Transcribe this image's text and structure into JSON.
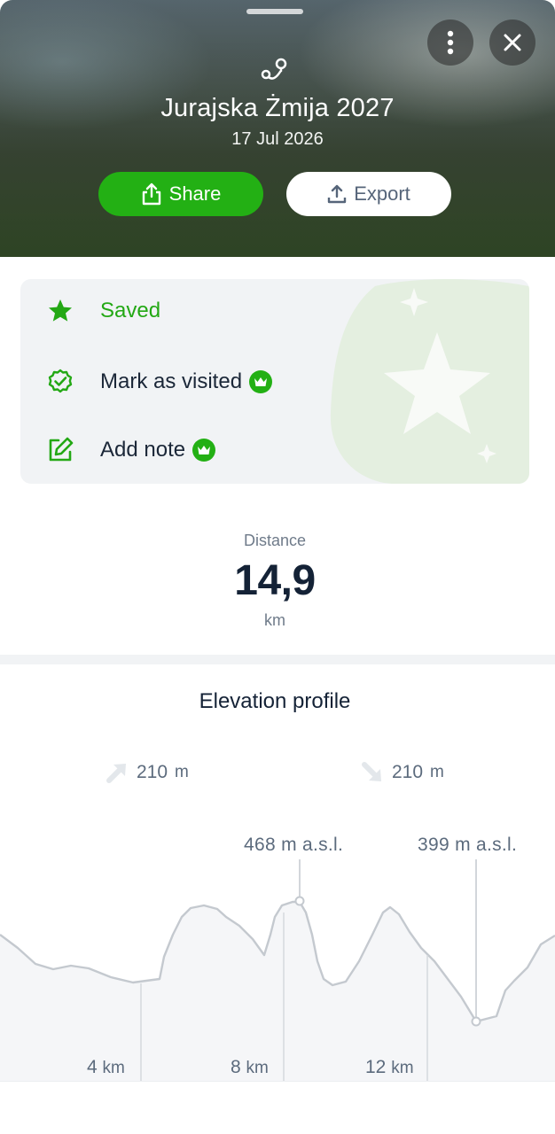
{
  "header": {
    "title": "Jurajska Żmija 2027",
    "date": "17 Jul 2026",
    "share_label": "Share",
    "export_label": "Export",
    "icons": [
      "more-vertical-icon",
      "close-icon",
      "route-icon",
      "share-icon",
      "upload-icon"
    ]
  },
  "card": {
    "items": [
      {
        "label": "Saved",
        "icon": "star-icon",
        "premium": false
      },
      {
        "label": "Mark as visited",
        "icon": "check-badge-icon",
        "premium": true
      },
      {
        "label": "Add note",
        "icon": "edit-note-icon",
        "premium": true
      }
    ]
  },
  "distance": {
    "label": "Distance",
    "value": "14,9",
    "unit": "km"
  },
  "elevation": {
    "title": "Elevation profile",
    "ascent": {
      "value": "210",
      "unit": "m"
    },
    "descent": {
      "value": "210",
      "unit": "m"
    },
    "peaks": [
      {
        "label": "468 m a.s.l."
      },
      {
        "label": "399 m a.s.l."
      }
    ],
    "km_markers": [
      {
        "value": "4",
        "unit": "km"
      },
      {
        "value": "8",
        "unit": "km"
      },
      {
        "value": "12",
        "unit": "km"
      }
    ]
  },
  "colors": {
    "accent_green": "#23b014",
    "text_dark": "#142236",
    "text_muted": "#6f7b8a",
    "card_bg": "#f1f3f5"
  }
}
